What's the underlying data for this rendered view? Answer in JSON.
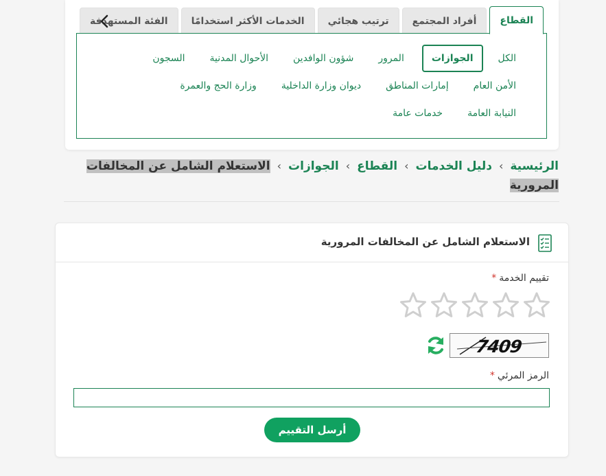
{
  "tabs": [
    {
      "label": "القطاع",
      "active": true
    },
    {
      "label": "أفراد المجتمع",
      "active": false
    },
    {
      "label": "ترتيب هجائي",
      "active": false
    },
    {
      "label": "الخدمات الأكثر استخدامًا",
      "active": false
    },
    {
      "label": "الفئة المستهدفة",
      "active": false
    }
  ],
  "sectors": {
    "row1": [
      "الكل",
      "الجوازات",
      "المرور",
      "شؤون الوافدين",
      "الأحوال المدنية",
      "السجون"
    ],
    "row2": [
      "الأمن العام",
      "إمارات المناطق",
      "ديوان وزارة الداخلية",
      "وزارة الحج والعمرة"
    ],
    "row3": [
      "النيابة العامة",
      "خدمات عامة"
    ],
    "active": "الجوازات"
  },
  "breadcrumb": {
    "items": [
      "الرئيسية",
      "دليل الخدمات",
      "القطاع",
      "الجوازات"
    ],
    "current": "الاستعلام الشامل عن المخالفات المرورية"
  },
  "service": {
    "title": "الاستعلام الشامل عن المخالفات المرورية",
    "rating_label": "تقييم الخدمة",
    "required_mark": "*",
    "rating_value": 0,
    "rating_max": 5,
    "captcha_text": "7409",
    "code_label": "الرمز المرئي",
    "code_value": "",
    "submit_label": "أرسل التقييم"
  },
  "colors": {
    "accent": "#1b8354",
    "button": "#10a160",
    "required": "#d0342c",
    "highlight": "#c0c0c0"
  },
  "icons": [
    "chevron-left-icon",
    "checklist-document-icon",
    "star-outline-icon",
    "refresh-icon"
  ]
}
